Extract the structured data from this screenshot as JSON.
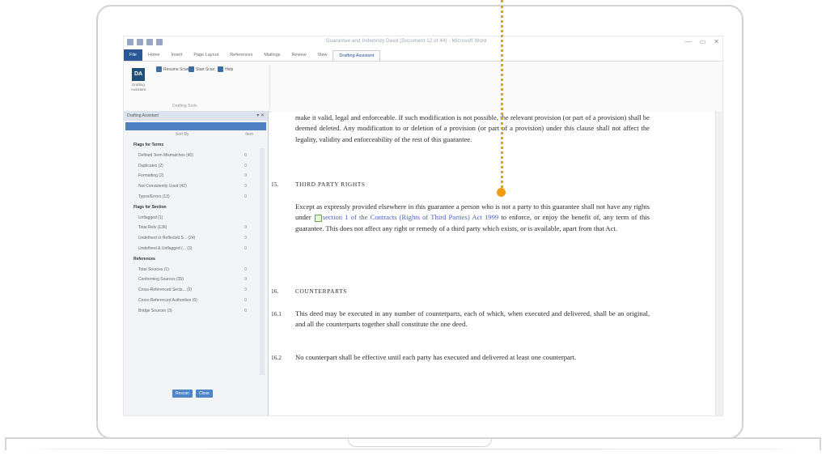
{
  "window": {
    "title": "Guarantee and Indemnity Deed (Document 12 of 44) - Microsoft Word",
    "controls": [
      "—",
      "▭",
      "✕"
    ]
  },
  "ribbon": {
    "tabs": [
      "File",
      "Home",
      "Insert",
      "Page Layout",
      "References",
      "Mailings",
      "Review",
      "View",
      "Drafting Assistant"
    ],
    "active_tab": "Drafting Assistant",
    "big_button": {
      "icon_text": "DA",
      "label": "Drafting Assistant"
    },
    "buttons": [
      "Resume Scan",
      "Start Scan",
      "Help"
    ],
    "group_label": "Drafting Tools"
  },
  "pane": {
    "title": "Drafting Assistant",
    "sort_label": "Sort By",
    "sort_count": "Item",
    "items": [
      {
        "label": "Flags for Terms",
        "count": "",
        "head": true
      },
      {
        "label": "Defined Term Mismatches (40)",
        "count": "0"
      },
      {
        "label": "Duplicates (2)",
        "count": "0"
      },
      {
        "label": "Formatting (2)",
        "count": "0"
      },
      {
        "label": "Not Consistently Used (42)",
        "count": "0"
      },
      {
        "label": "Typos/Errors (13)",
        "count": "0"
      },
      {
        "label": "Flags for Section",
        "count": "",
        "head": true
      },
      {
        "label": "Unflagged (1)",
        "count": ""
      },
      {
        "label": "Total Refs (136)",
        "count": "0"
      },
      {
        "label": "Undefined or Reflected S... (24)",
        "count": "0"
      },
      {
        "label": "Undefined & Unflagged (... (3)",
        "count": "0"
      },
      {
        "label": "References",
        "count": "",
        "head": true
      },
      {
        "label": "Total Sources (1)",
        "count": "0"
      },
      {
        "label": "Conforming Sources (35)",
        "count": "0"
      },
      {
        "label": "Cross-Referenced Sects... (2)",
        "count": "0"
      },
      {
        "label": "Cross-Referenced Authorities (6)",
        "count": "0"
      },
      {
        "label": "Bridge Sources (3)",
        "count": "0"
      }
    ],
    "buttons": [
      "Rescan",
      "Close"
    ]
  },
  "document": {
    "para_top": "make it valid, legal and enforceable. If such modification is not possible, the relevant provision (or part of a provision) shall be deemed deleted. Any modification to or deletion of a provision (or part of a provision) under this clause shall not affect the legality, validity and enforceability of the rest of this guarantee.",
    "s15_num": "15.",
    "s15_heading": "THIRD PARTY RIGHTS",
    "s15_pre": "Except as expressly provided elsewhere in this guarantee a person who is not a party to this guarantee shall not have any rights under ",
    "s15_link": "section 1 of the Contracts (Rights of Third Parties) Act 1999",
    "s15_post": " to enforce, or enjoy the benefit of, any term of this guarantee. This does not affect any right or remedy of a third party which exists, or is available, apart from that Act.",
    "s16_num": "16.",
    "s16_heading": "COUNTERPARTS",
    "s161_num": "16.1",
    "s161_text": "This deed may be executed in any number of counterparts, each of which, when executed and delivered, shall be an original, and all the counterparts together shall constitute the one deed.",
    "s162_num": "16.2",
    "s162_text": "No counterpart shall be effective until each party has executed and delivered at least one counterpart."
  },
  "colors": {
    "accent": "#2b5797",
    "callout": "#f39c12",
    "link": "#4a5fbf"
  }
}
